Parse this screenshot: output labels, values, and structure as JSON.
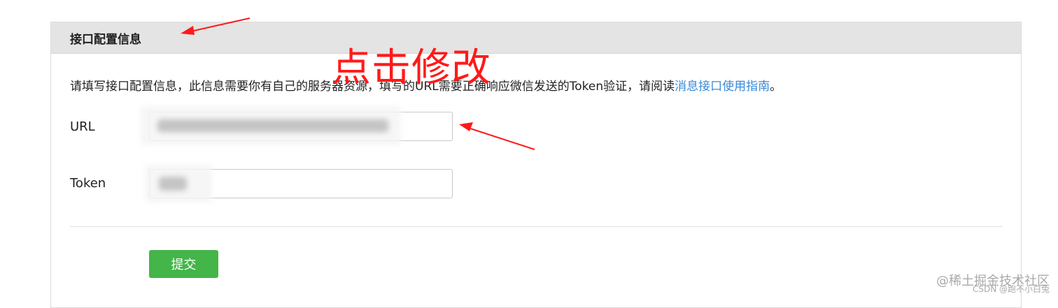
{
  "panel": {
    "title": "接口配置信息"
  },
  "description": {
    "text_before_link": "请填写接口配置信息，此信息需要你有自己的服务器资源，填写的URL需要正确响应微信发送的Token验证，请阅读",
    "link_text": "消息接口使用指南",
    "text_after_link": "。"
  },
  "fields": {
    "url_label": "URL",
    "token_label": "Token"
  },
  "form": {
    "submit_label": "提交"
  },
  "annotation": {
    "text": "点击修改",
    "color": "#ff1a1a"
  },
  "watermark": {
    "line1": "@稀土掘金技术社区",
    "line2": "CSDN @跑不小白兔"
  },
  "colors": {
    "header_bg": "#e4e4e4",
    "link": "#3a8ad6",
    "submit_bg": "#44b549",
    "annotation": "#ff1a1a"
  }
}
